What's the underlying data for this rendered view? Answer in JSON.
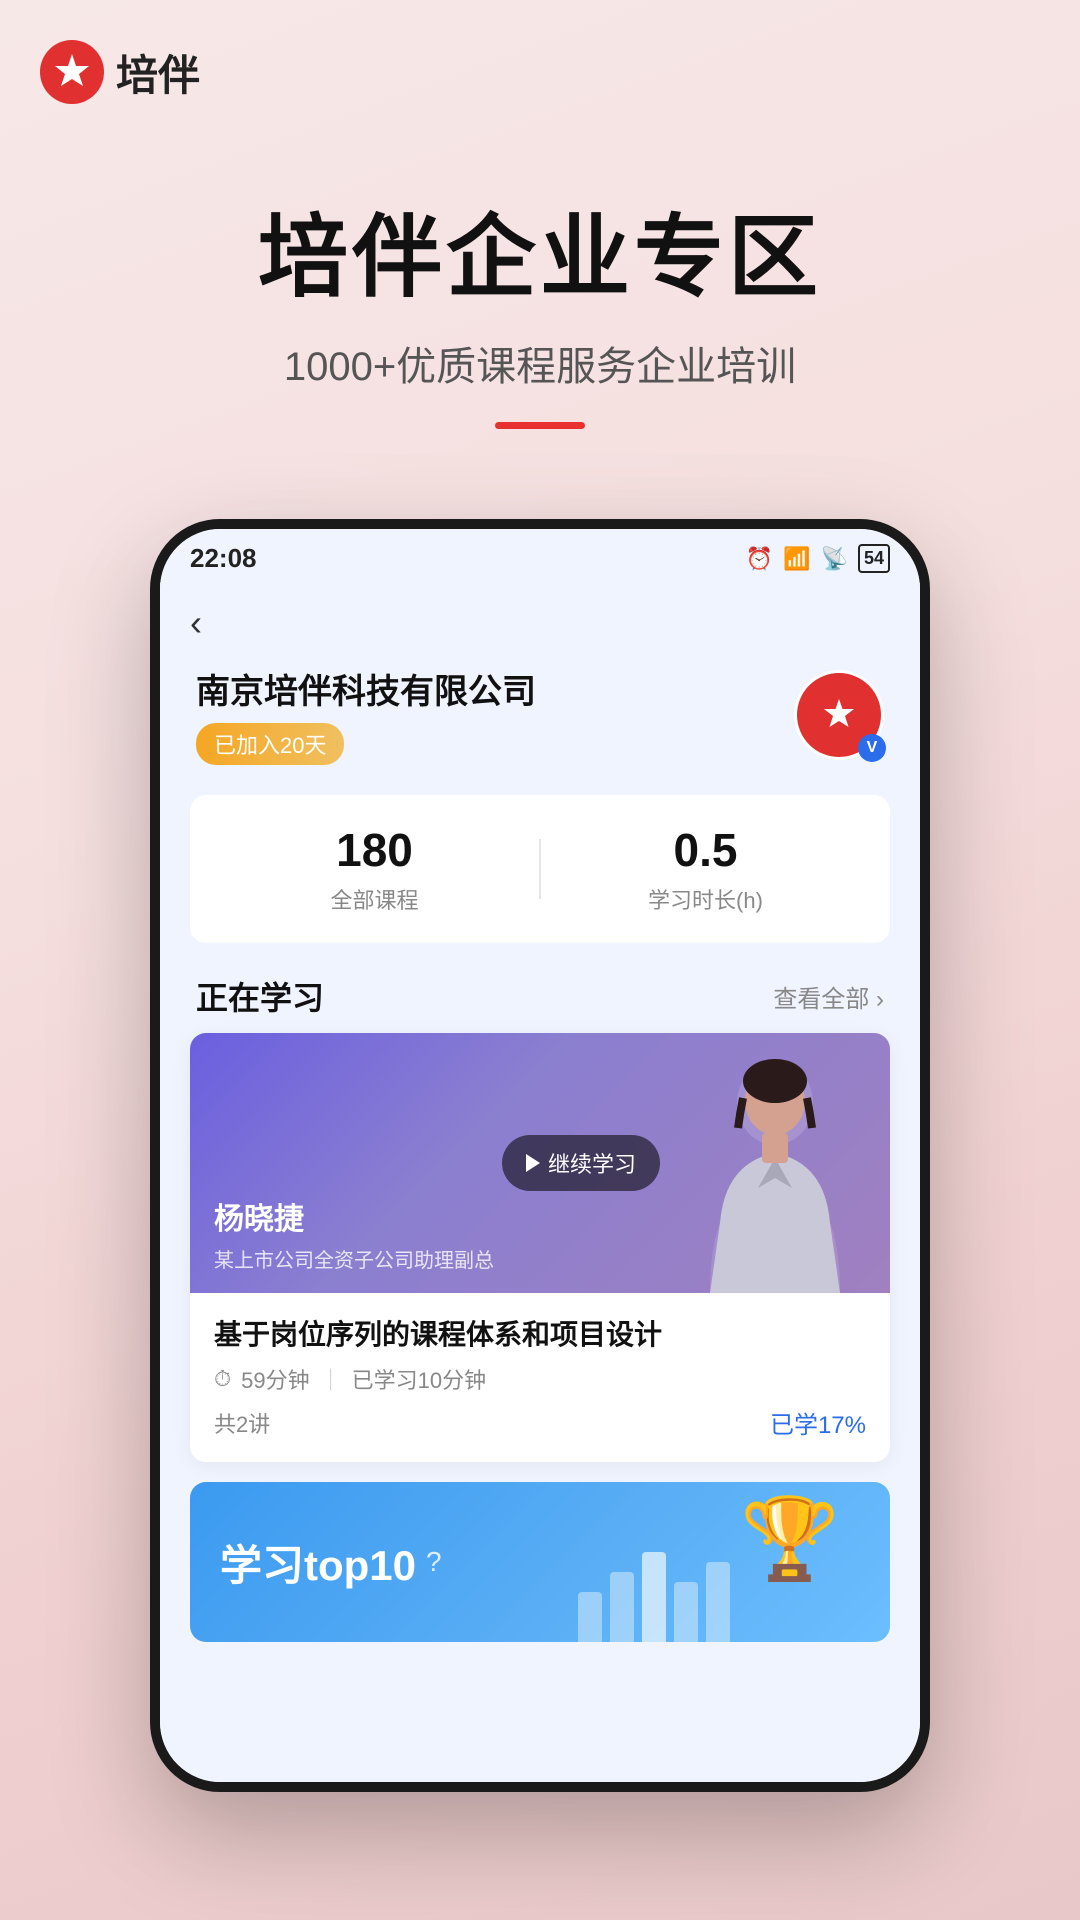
{
  "header": {
    "logo_text": "培伴",
    "time": "22:08",
    "battery": "54"
  },
  "hero": {
    "title": "培伴企业专区",
    "subtitle": "1000+优质课程服务企业培训"
  },
  "phone": {
    "back_label": "‹",
    "company": {
      "name": "南京培伴科技有限公司",
      "badge": "已加入20天"
    },
    "stats": {
      "courses_value": "180",
      "courses_label": "全部课程",
      "hours_value": "0.5",
      "hours_label": "学习时长(h)"
    },
    "studying": {
      "section_title": "正在学习",
      "section_link": "查看全部 ›",
      "course": {
        "teacher_name": "杨晓捷",
        "teacher_title": "某上市公司全资子公司助理副总",
        "continue_label": "继续学习",
        "title": "基于岗位序列的课程体系和项目设计",
        "duration": "59分钟",
        "studied": "已学习10分钟",
        "lessons": "共2讲",
        "progress": "已学17%"
      }
    },
    "top10": {
      "label": "学习top10",
      "question_icon": "?",
      "trophy_icon": "🏆",
      "columns": [
        50,
        70,
        90,
        60,
        80
      ]
    }
  }
}
